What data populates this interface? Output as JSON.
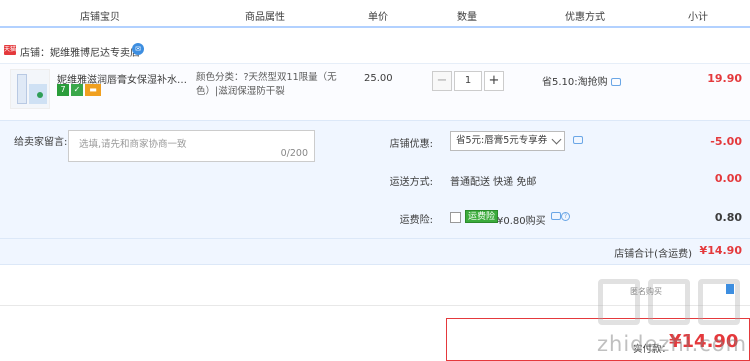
{
  "header": {
    "col_shop_item": "店铺宝贝",
    "col_attributes": "商品属性",
    "col_unit_price": "单价",
    "col_quantity": "数量",
    "col_discount": "优惠方式",
    "col_subtotal": "小计"
  },
  "shop": {
    "badge": "天猫",
    "name": "店铺：妮维雅博尼达专卖店"
  },
  "item": {
    "title": "妮维雅滋润唇膏女保湿补水变色...",
    "attributes": "颜色分类：?天然型双11限量（无色）|滋润保湿防干裂",
    "unit_price": "25.00",
    "quantity": "1",
    "promo": "省5.10:淘抢购",
    "subtotal": "19.90"
  },
  "message": {
    "label": "给卖家留言:",
    "placeholder": "选填,请先和商家协商一致",
    "counter": "0/200"
  },
  "shop_discount": {
    "label": "店铺优惠:",
    "selected": "省5元:唇膏5元专享券",
    "value": "-5.00"
  },
  "shipping": {
    "label": "运送方式:",
    "value": "普通配送 快递 免邮",
    "amount": "0.00"
  },
  "insurance": {
    "label": "运费险:",
    "tag": "运费险",
    "text": "¥0.80购买",
    "amount": "0.80"
  },
  "shop_total": {
    "label": "店铺合计(含运费)",
    "value": "¥14.90"
  },
  "footer": {
    "partial_text": "匿名购买",
    "pay_label": "实付款：",
    "pay_value": "¥14.90"
  },
  "watermark": {
    "url": "zhidezhi.com"
  },
  "colors": {
    "accent_red": "#e4393c",
    "panel_bg": "#f0f6ff",
    "header_line": "#b2d1ff"
  }
}
